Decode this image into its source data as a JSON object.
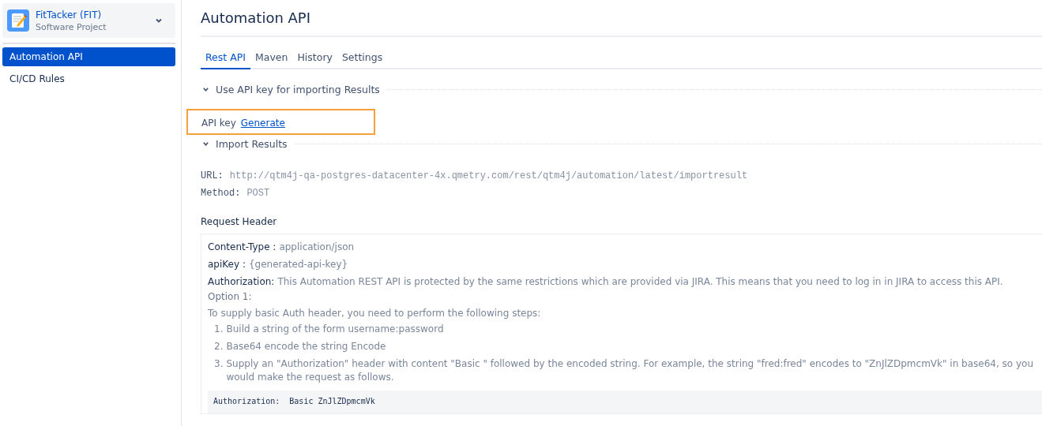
{
  "project": {
    "name": "FitTacker (FIT)",
    "type": "Software Project"
  },
  "sidebar": {
    "items": [
      {
        "label": "Automation API",
        "selected": true
      },
      {
        "label": "CI/CD Rules",
        "selected": false
      }
    ]
  },
  "page": {
    "title": "Automation API"
  },
  "tabs": [
    {
      "label": "Rest API",
      "selected": true
    },
    {
      "label": "Maven",
      "selected": false
    },
    {
      "label": "History",
      "selected": false
    },
    {
      "label": "Settings",
      "selected": false
    }
  ],
  "api_key_section": {
    "title": "Use API key for importing Results",
    "expanded": true,
    "label": "API key",
    "link": "Generate",
    "highlighted": true
  },
  "import_section": {
    "title": "Import Results",
    "expanded": true,
    "url_label": "URL:",
    "url": "http://qtm4j-qa-postgres-datacenter-4x.qmetry.com/rest/qtm4j/automation/latest/importresult",
    "method_label": "Method:",
    "method": "POST",
    "request_header_title": "Request Header",
    "headers": [
      {
        "name": "Content-Type :",
        "value": "application/json"
      },
      {
        "name": "apiKey :",
        "value": "{generated-api-key}"
      },
      {
        "name": "Authorization:",
        "value": "This Automation REST API is protected by the same restrictions which are provided via JIRA. This means that you need to log in in JIRA to access this API."
      }
    ],
    "option": "Option 1:",
    "intro": "To supply basic Auth header, you need to perform the following steps:",
    "steps": [
      {
        "number": "1.",
        "text": "Build a string of the form username:password"
      },
      {
        "number": "2.",
        "text": "Base64 encode the string Encode"
      },
      {
        "number": "3.",
        "text": "Supply an \"Authorization\" header with content \"Basic \" followed by the encoded string. For example, the string \"fred:fred\" encodes to \"ZnJlZDpmcmVk\" in base64, so you would make the request as follows."
      }
    ],
    "code": "Authorization:  Basic ZnJlZDpmcmVk"
  }
}
